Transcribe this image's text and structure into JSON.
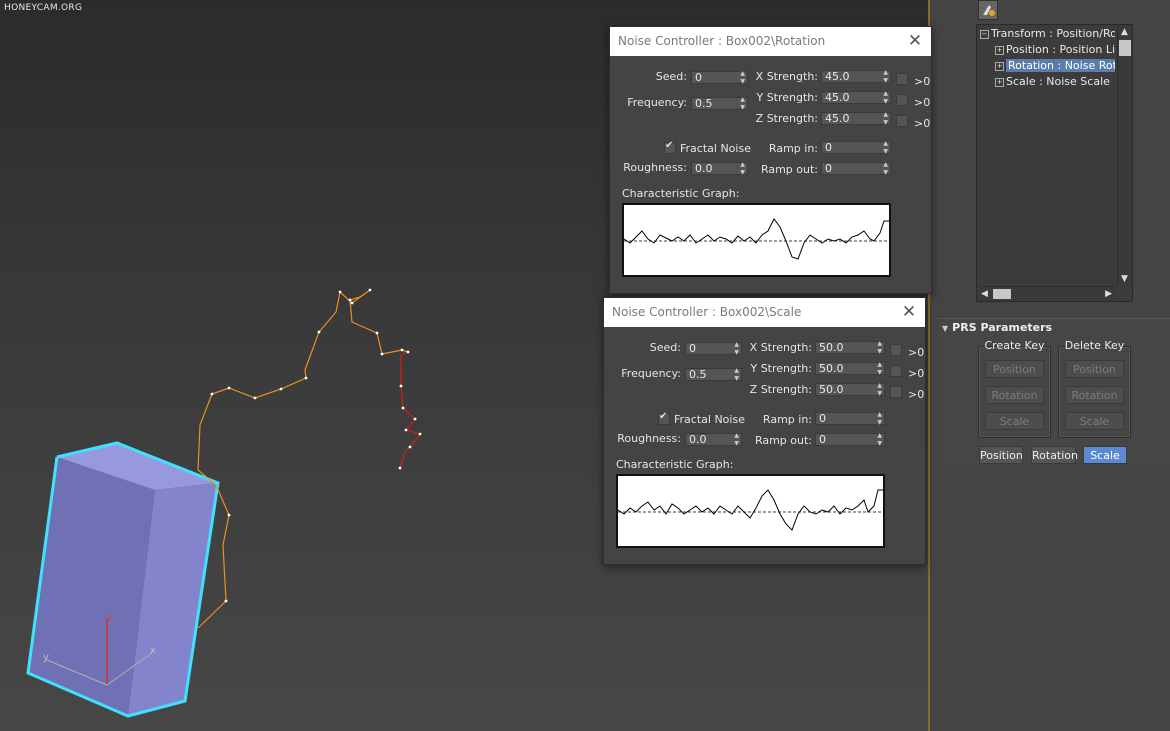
{
  "watermark": "HONEYCAM.ORG",
  "dialogs": {
    "rotation": {
      "title": "Noise Controller : Box002\\Rotation",
      "seed_label": "Seed:",
      "seed": "0",
      "frequency_label": "Frequency:",
      "frequency": "0.5",
      "x_strength_label": "X Strength:",
      "x_strength": "45.0",
      "y_strength_label": "Y Strength:",
      "y_strength": "45.0",
      "z_strength_label": "Z Strength:",
      "z_strength": "45.0",
      "gt0_label": ">0",
      "fractal_label": "Fractal Noise",
      "roughness_label": "Roughness:",
      "roughness": "0.0",
      "ramp_in_label": "Ramp in:",
      "ramp_in": "0",
      "ramp_out_label": "Ramp out:",
      "ramp_out": "0",
      "graph_label": "Characteristic Graph:"
    },
    "scale": {
      "title": "Noise Controller : Box002\\Scale",
      "seed_label": "Seed:",
      "seed": "0",
      "frequency_label": "Frequency:",
      "frequency": "0.5",
      "x_strength_label": "X Strength:",
      "x_strength": "50.0",
      "y_strength_label": "Y Strength:",
      "y_strength": "50.0",
      "z_strength_label": "Z Strength:",
      "z_strength": "50.0",
      "gt0_label": ">0",
      "fractal_label": "Fractal Noise",
      "roughness_label": "Roughness:",
      "roughness": "0.0",
      "ramp_in_label": "Ramp in:",
      "ramp_in": "0",
      "ramp_out_label": "Ramp out:",
      "ramp_out": "0",
      "graph_label": "Characteristic Graph:"
    }
  },
  "tree": {
    "items": [
      {
        "label": "Transform : Position/Rotation/Scale",
        "expander": "−"
      },
      {
        "label": "Position : Position List",
        "expander": "+"
      },
      {
        "label": "Rotation : Noise Rotation",
        "expander": "+"
      },
      {
        "label": "Scale : Noise Scale",
        "expander": "+"
      }
    ]
  },
  "prs": {
    "title": "PRS Parameters",
    "create_key_label": "Create Key",
    "delete_key_label": "Delete Key",
    "position": "Position",
    "rotation": "Rotation",
    "scale": "Scale"
  },
  "viewport": {
    "axis_z": "z",
    "axis_x": "x",
    "axis_y": "y"
  },
  "colors": {
    "box": "#8080c8",
    "selection": "#40e0ff",
    "active_button": "#5b8ad4"
  }
}
